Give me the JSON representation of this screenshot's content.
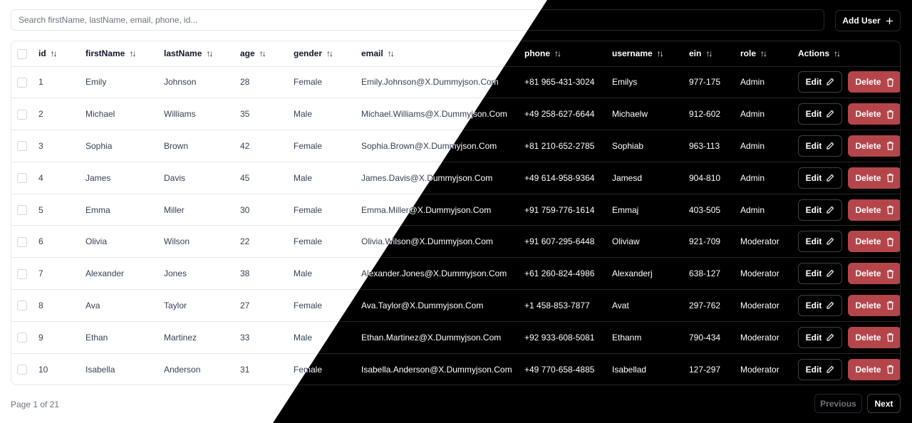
{
  "search": {
    "placeholder": "Search firstName, lastName, email, phone, id..."
  },
  "toolbar": {
    "add_user_label": "Add User"
  },
  "table": {
    "columns": [
      "id",
      "firstName",
      "lastName",
      "age",
      "gender",
      "email",
      "phone",
      "username",
      "ein",
      "role",
      "Actions"
    ],
    "rows": [
      [
        "1",
        "Emily",
        "Johnson",
        "28",
        "Female",
        "Emily.Johnson@X.Dummyjson.Com",
        "+81 965-431-3024",
        "Emilys",
        "977-175",
        "Admin"
      ],
      [
        "2",
        "Michael",
        "Williams",
        "35",
        "Male",
        "Michael.Williams@X.Dummyjson.Com",
        "+49 258-627-6644",
        "Michaelw",
        "912-602",
        "Admin"
      ],
      [
        "3",
        "Sophia",
        "Brown",
        "42",
        "Female",
        "Sophia.Brown@X.Dummyjson.Com",
        "+81 210-652-2785",
        "Sophiab",
        "963-113",
        "Admin"
      ],
      [
        "4",
        "James",
        "Davis",
        "45",
        "Male",
        "James.Davis@X.Dummyjson.Com",
        "+49 614-958-9364",
        "Jamesd",
        "904-810",
        "Admin"
      ],
      [
        "5",
        "Emma",
        "Miller",
        "30",
        "Female",
        "Emma.Miller@X.Dummyjson.Com",
        "+91 759-776-1614",
        "Emmaj",
        "403-505",
        "Admin"
      ],
      [
        "6",
        "Olivia",
        "Wilson",
        "22",
        "Female",
        "Olivia.Wilson@X.Dummyjson.Com",
        "+91 607-295-6448",
        "Oliviaw",
        "921-709",
        "Moderator"
      ],
      [
        "7",
        "Alexander",
        "Jones",
        "38",
        "Male",
        "Alexander.Jones@X.Dummyjson.Com",
        "+61 260-824-4986",
        "Alexanderj",
        "638-127",
        "Moderator"
      ],
      [
        "8",
        "Ava",
        "Taylor",
        "27",
        "Female",
        "Ava.Taylor@X.Dummyjson.Com",
        "+1 458-853-7877",
        "Avat",
        "297-762",
        "Moderator"
      ],
      [
        "9",
        "Ethan",
        "Martinez",
        "33",
        "Male",
        "Ethan.Martinez@X.Dummyjson.Com",
        "+92 933-608-5081",
        "Ethanm",
        "790-434",
        "Moderator"
      ],
      [
        "10",
        "Isabella",
        "Anderson",
        "31",
        "Female",
        "Isabella.Anderson@X.Dummyjson.Com",
        "+49 770-658-4885",
        "Isabellad",
        "127-297",
        "Moderator"
      ]
    ],
    "edit_label": "Edit",
    "delete_label": "Delete"
  },
  "pagination": {
    "page_label": "Page 1 of 21",
    "previous_label": "Previous",
    "next_label": "Next"
  },
  "icons": {
    "sort": "sort-arrows-icon",
    "add": "plus-icon",
    "edit": "pencil-icon",
    "delete": "trash-icon"
  },
  "colors": {
    "delete_button": "#b4464b"
  }
}
